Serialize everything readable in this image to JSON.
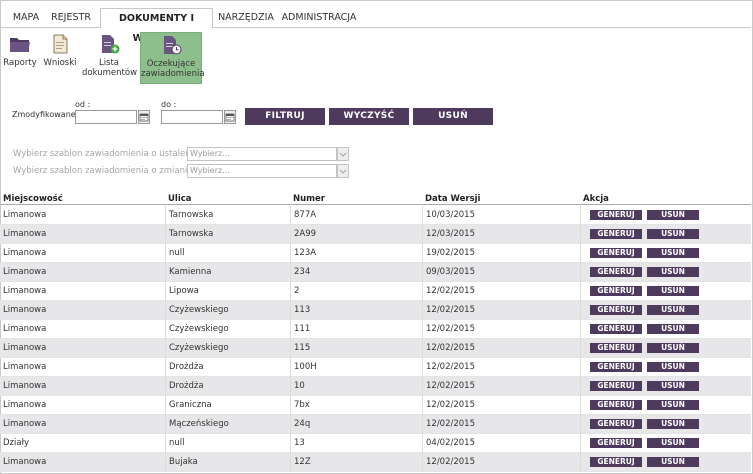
{
  "tabs": [
    "MAPA",
    "REJESTR",
    "DOKUMENTY I WNIOSKI",
    "NARZĘDZIA",
    "ADMINISTRACJA"
  ],
  "active_tab": "DOKUMENTY I WNIOSKI",
  "toolbar": {
    "reports_label": "Raporty",
    "requests_label": "Wnioski",
    "list_label_1": "Lista",
    "list_label_2": "dokumentów",
    "pending_label_1": "Oczekujące",
    "pending_label_2": "zawiadomienia"
  },
  "filter": {
    "modified_label": "Zmodyfikowane:",
    "from_label": "od :",
    "to_label": "do :",
    "from_value": "",
    "to_value": "",
    "filter_button": "FILTRUJ",
    "clear_button": "WYCZYŚĆ",
    "delete_button": "USUŃ"
  },
  "templates": {
    "determination_label": "Wybierz szablon zawiadomienia o ustaleniu",
    "change_label": "Wybierz szablon zawiadomienia o zmianie",
    "required_mark": "*",
    "colon": ":",
    "placeholder": "Wybierz..."
  },
  "table": {
    "headers": [
      "Miejscowość",
      "Ulica",
      "Numer",
      "Data Wersji",
      "Akcja"
    ],
    "generate_label": "GENERUJ",
    "delete_label": "USUŃ",
    "rows": [
      [
        "Limanowa",
        "Tarnowska",
        "877A",
        "10/03/2015"
      ],
      [
        "Limanowa",
        "Tarnowska",
        "2A99",
        "12/03/2015"
      ],
      [
        "Limanowa",
        "null",
        "123A",
        "19/02/2015"
      ],
      [
        "Limanowa",
        "Kamienna",
        "234",
        "09/03/2015"
      ],
      [
        "Limanowa",
        "Lipowa",
        "2",
        "12/02/2015"
      ],
      [
        "Limanowa",
        "Czyżewskiego",
        "113",
        "12/02/2015"
      ],
      [
        "Limanowa",
        "Czyżewskiego",
        "111",
        "12/02/2015"
      ],
      [
        "Limanowa",
        "Czyżewskiego",
        "115",
        "12/02/2015"
      ],
      [
        "Limanowa",
        "Drożdża",
        "100H",
        "12/02/2015"
      ],
      [
        "Limanowa",
        "Drożdża",
        "10",
        "12/02/2015"
      ],
      [
        "Limanowa",
        "Graniczna",
        "7bx",
        "12/02/2015"
      ],
      [
        "Limanowa",
        "Mączeńskiego",
        "24q",
        "12/02/2015"
      ],
      [
        "Działy",
        "null",
        "13",
        "04/02/2015"
      ],
      [
        "Limanowa",
        "Bujaka",
        "12Z",
        "12/02/2015"
      ]
    ]
  },
  "colors": {
    "accent": "#4e3a5c",
    "selected_tool": "#8dbf8d",
    "row_alt": "#e7e7ea"
  }
}
